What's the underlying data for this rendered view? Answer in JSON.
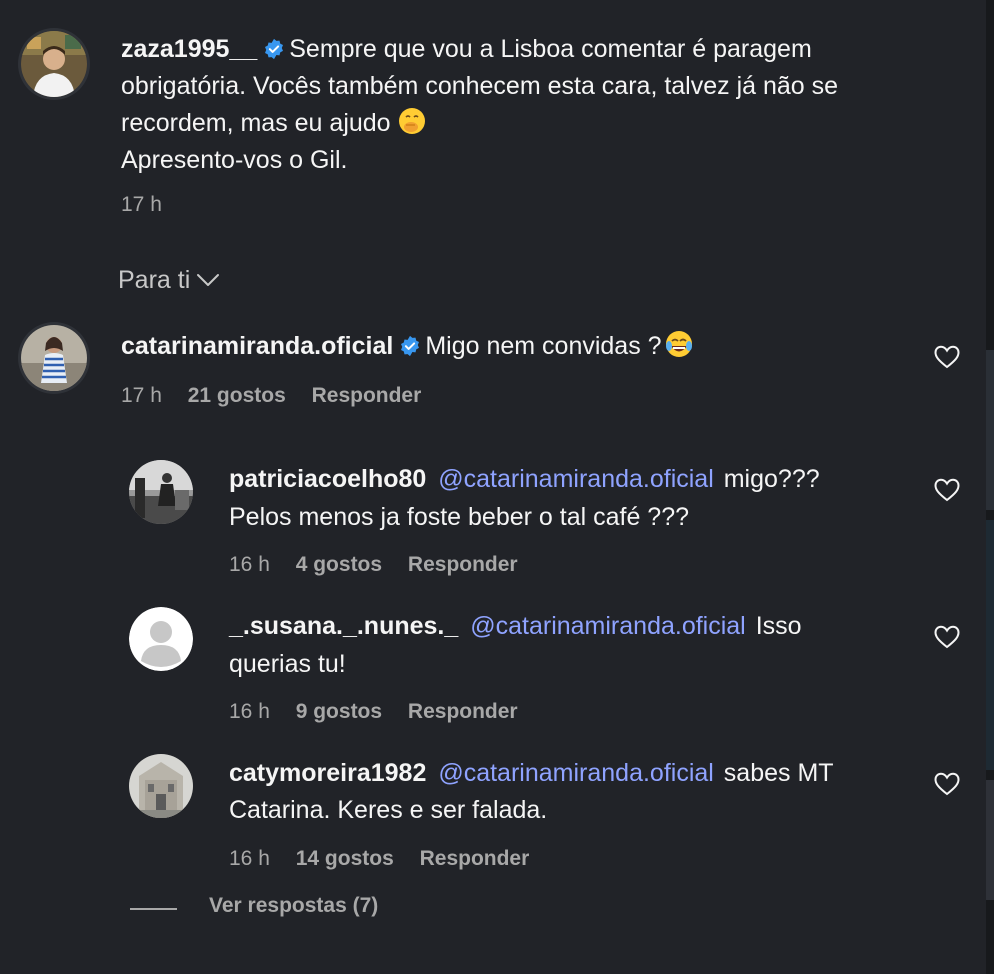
{
  "post": {
    "username": "zaza1995__",
    "text_lines": [
      "Sempre que vou a Lisboa comentar é paragem",
      "obrigatória. Vocês também conhecem esta cara, talvez já não se",
      "recordem, mas eu ajudo",
      "Apresento-vos o Gil."
    ],
    "time": "17 h"
  },
  "sort_label": "Para ti",
  "comment": {
    "username": "catarinamiranda.oficial",
    "text": "Migo nem convidas ?",
    "time": "17 h",
    "likes": "21 gostos",
    "reply": "Responder"
  },
  "replies": [
    {
      "username": "patriciacoelho80",
      "mention": "@catarinamiranda.oficial",
      "text1": "migo???",
      "text2": "Pelos menos ja foste beber o tal café ???",
      "time": "16 h",
      "likes": "4 gostos",
      "reply": "Responder"
    },
    {
      "username": "_.susana._.nunes._",
      "mention": "@catarinamiranda.oficial",
      "text1": "Isso",
      "text2": "querias tu!",
      "time": "16 h",
      "likes": "9 gostos",
      "reply": "Responder"
    },
    {
      "username": "catymoreira1982",
      "mention": "@catarinamiranda.oficial",
      "text1": "sabes MT",
      "text2": "Catarina. Keres e ser falada.",
      "time": "16 h",
      "likes": "14 gostos",
      "reply": "Responder"
    }
  ],
  "view_replies": "Ver respostas (7)",
  "icons": {
    "verified": "verified-badge-icon",
    "heart": "heart-outline-icon",
    "chevron": "chevron-down-icon",
    "emoji_post": "face-with-hand-over-mouth-emoji",
    "emoji_comment": "tears-of-joy-emoji"
  },
  "colors": {
    "background": "#212328",
    "mention": "#8fa3ff",
    "verified": "#3897f0",
    "meta": "#a8a8a8"
  }
}
